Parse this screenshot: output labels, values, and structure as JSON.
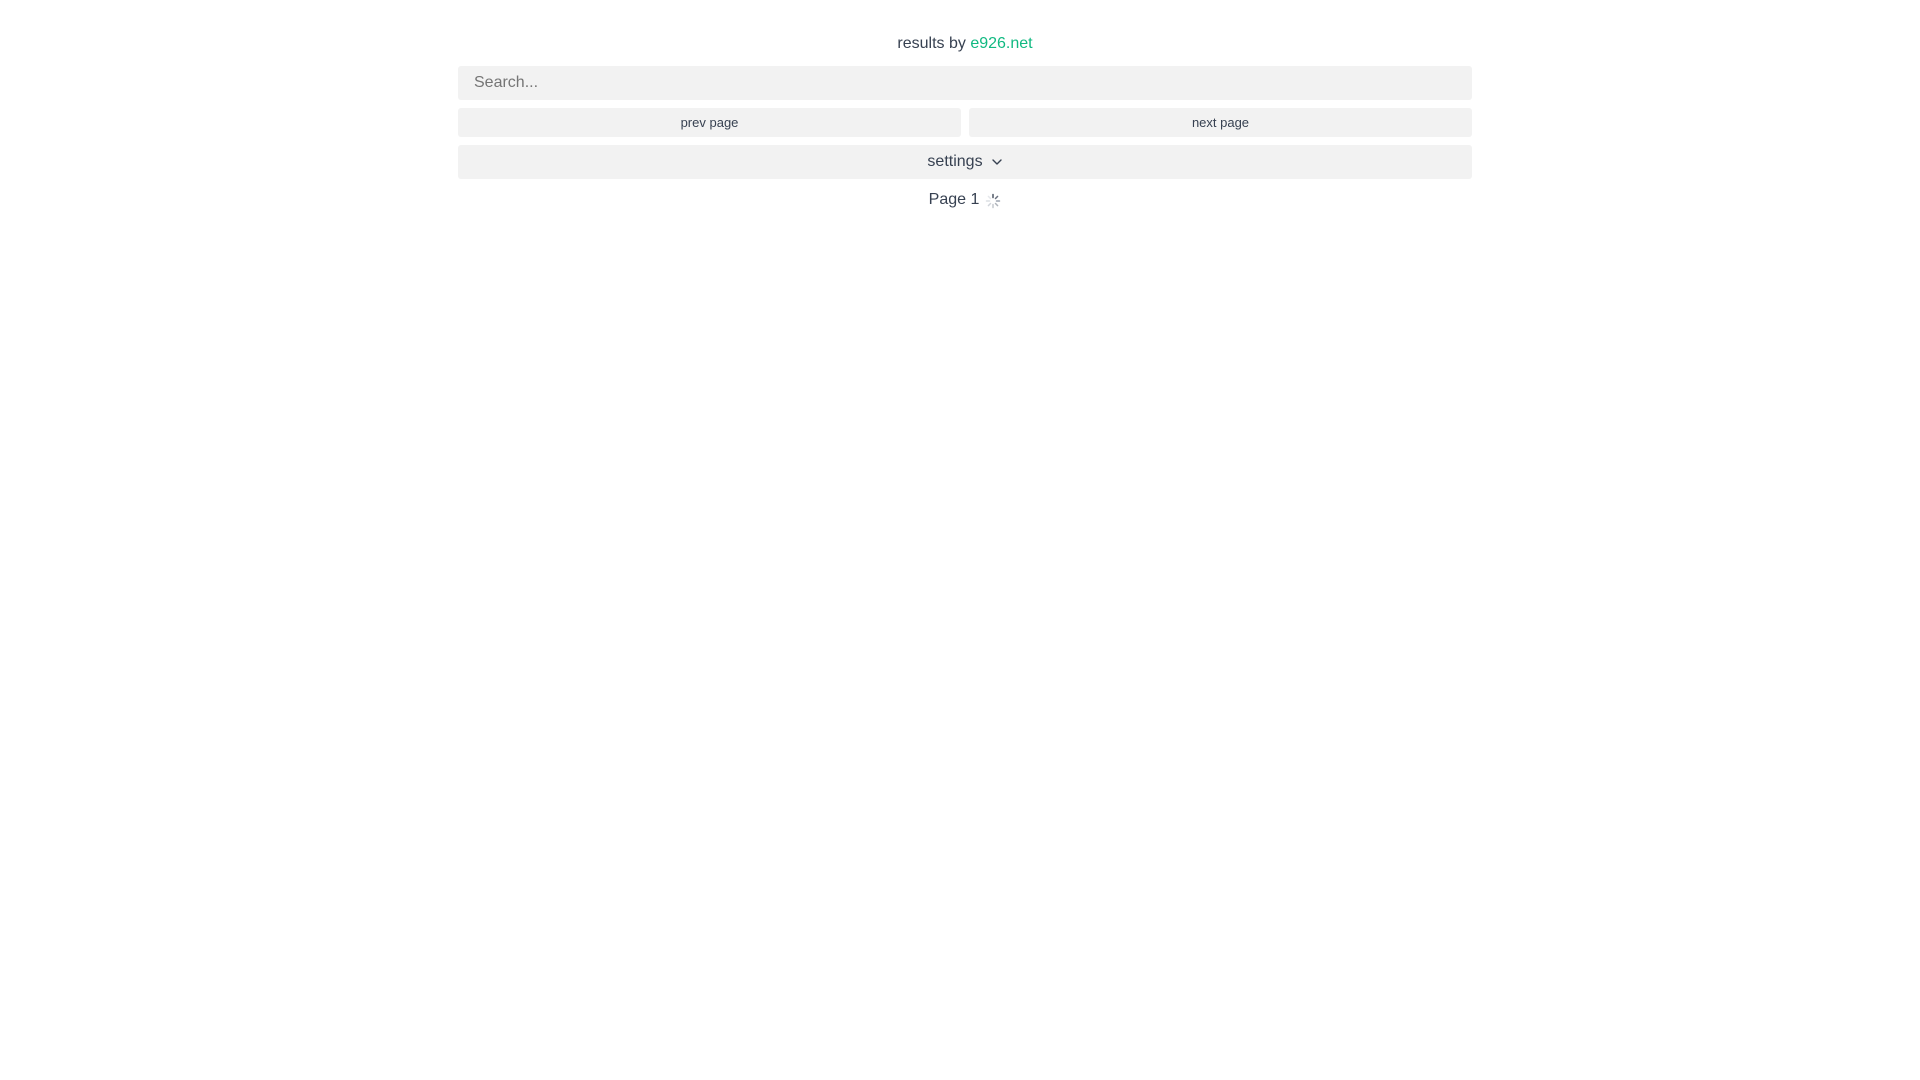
{
  "header": {
    "credit_prefix": "results by",
    "credit_link": "e926.net",
    "link_color": "#10b981"
  },
  "search": {
    "placeholder": "Search...",
    "value": ""
  },
  "pagination": {
    "prev_label": "prev page",
    "next_label": "next page"
  },
  "settings": {
    "label": "settings",
    "icon": "chevron-down-icon"
  },
  "status": {
    "page_label": "Page 1",
    "icon": "loading-spinner-icon"
  }
}
